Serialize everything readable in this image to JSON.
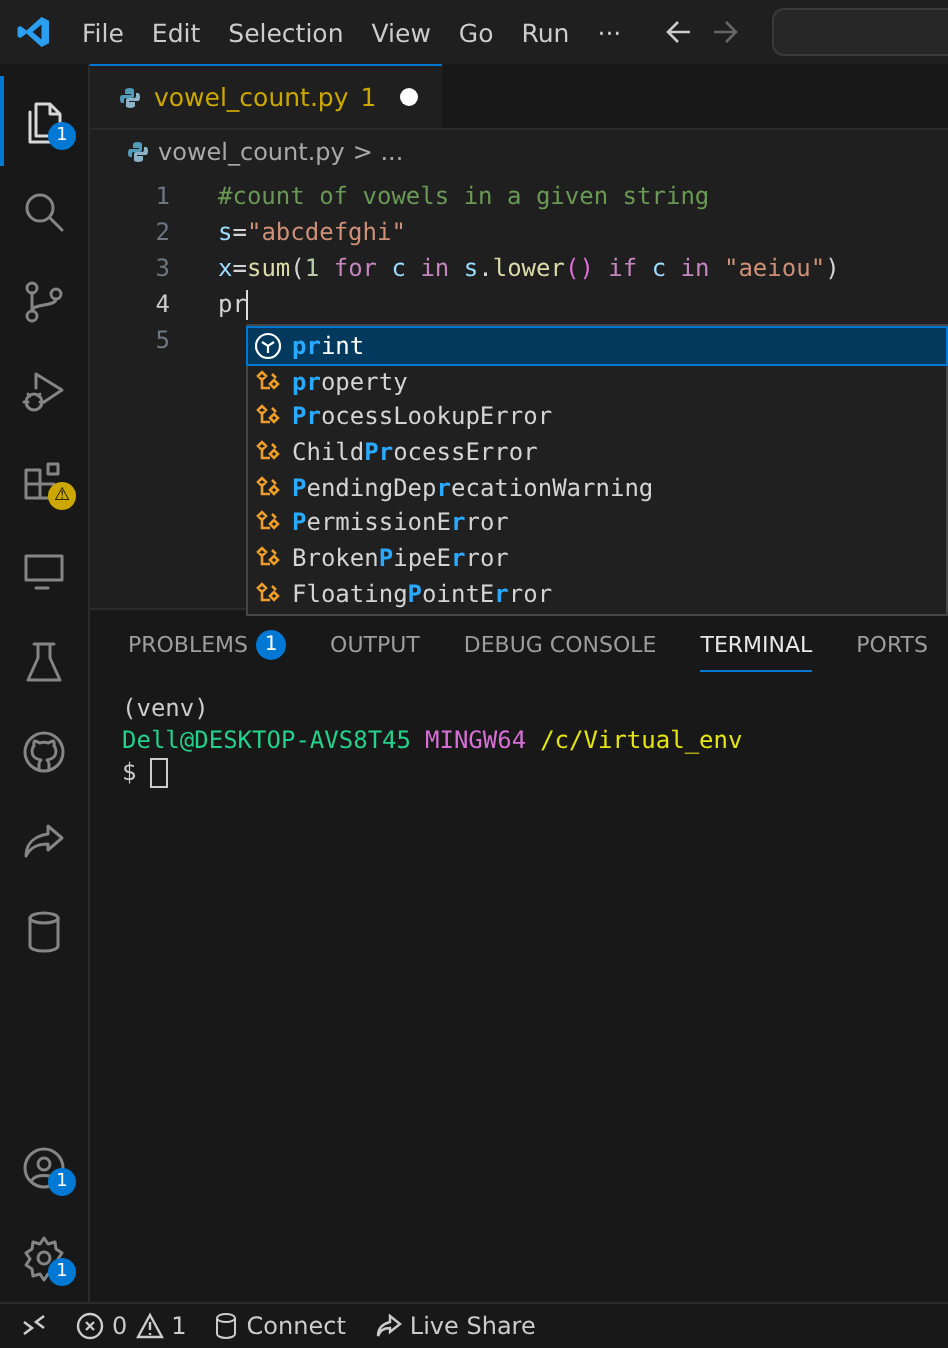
{
  "menu": [
    "File",
    "Edit",
    "Selection",
    "View",
    "Go",
    "Run",
    "···"
  ],
  "activity_bar": [
    {
      "kind": "files",
      "badge": "1",
      "selected": true
    },
    {
      "kind": "search",
      "selected": false
    },
    {
      "kind": "branch",
      "selected": false
    },
    {
      "kind": "debug",
      "selected": false
    },
    {
      "kind": "extensions",
      "badge": "⚠",
      "selected": false
    },
    {
      "kind": "remote",
      "selected": false
    },
    {
      "kind": "flask",
      "selected": false
    },
    {
      "kind": "github",
      "selected": false
    },
    {
      "kind": "share",
      "selected": false
    },
    {
      "kind": "database",
      "selected": false
    }
  ],
  "activity_bottom": [
    {
      "kind": "account",
      "badge": "1"
    },
    {
      "kind": "gear",
      "badge": "1"
    }
  ],
  "tab": {
    "name": "vowel_count.py",
    "problems": "1",
    "modified": true
  },
  "breadcrumb": {
    "file": "vowel_count.py",
    "rest": "> ..."
  },
  "code": [
    {
      "number": "1",
      "current": false,
      "tokens": [
        {
          "kind": "comment",
          "text": "#count of vowels in a given string"
        }
      ]
    },
    {
      "number": "2",
      "current": false,
      "tokens": [
        {
          "kind": "name",
          "text": "s"
        },
        {
          "kind": "plain",
          "text": "="
        },
        {
          "kind": "string",
          "text": "\"abcdefghi\""
        }
      ]
    },
    {
      "number": "3",
      "current": false,
      "tokens": [
        {
          "kind": "name",
          "text": "x"
        },
        {
          "kind": "plain",
          "text": "="
        },
        {
          "kind": "func",
          "text": "sum"
        },
        {
          "kind": "plain",
          "text": "("
        },
        {
          "kind": "number",
          "text": "1"
        },
        {
          "kind": "keyword",
          "text": " for "
        },
        {
          "kind": "name",
          "text": "c"
        },
        {
          "kind": "keyword",
          "text": " in "
        },
        {
          "kind": "name",
          "text": "s"
        },
        {
          "kind": "plain",
          "text": "."
        },
        {
          "kind": "func",
          "text": "lower"
        },
        {
          "kind": "paren",
          "text": "()"
        },
        {
          "kind": "keyword",
          "text": " if "
        },
        {
          "kind": "name",
          "text": "c"
        },
        {
          "kind": "keyword",
          "text": " in "
        },
        {
          "kind": "string",
          "text": "\"aeiou\""
        },
        {
          "kind": "plain",
          "text": ")"
        }
      ]
    },
    {
      "number": "4",
      "current": true,
      "tokens": [
        {
          "kind": "plain",
          "text": "pr"
        }
      ]
    },
    {
      "number": "5",
      "current": false
    }
  ],
  "suggestions": [
    {
      "kind": "function",
      "selected": true,
      "parts": [
        {
          "text": "pr",
          "match": true
        },
        {
          "text": "int",
          "match": false
        }
      ]
    },
    {
      "kind": "class",
      "selected": false,
      "parts": [
        {
          "text": "pr",
          "match": true
        },
        {
          "text": "operty",
          "match": false
        }
      ]
    },
    {
      "kind": "class",
      "selected": false,
      "parts": [
        {
          "text": "Pr",
          "match": true
        },
        {
          "text": "ocessLookupError",
          "match": false
        }
      ]
    },
    {
      "kind": "class",
      "selected": false,
      "parts": [
        {
          "text": "Child",
          "match": false
        },
        {
          "text": "Pr",
          "match": true
        },
        {
          "text": "ocessError",
          "match": false
        }
      ]
    },
    {
      "kind": "class",
      "selected": false,
      "parts": [
        {
          "text": "P",
          "match": true
        },
        {
          "text": "endingDep",
          "match": false
        },
        {
          "text": "r",
          "match": true
        },
        {
          "text": "ecationWarning",
          "match": false
        }
      ]
    },
    {
      "kind": "class",
      "selected": false,
      "parts": [
        {
          "text": "P",
          "match": true
        },
        {
          "text": "ermissionE",
          "match": false
        },
        {
          "text": "r",
          "match": true
        },
        {
          "text": "ror",
          "match": false
        }
      ]
    },
    {
      "kind": "class",
      "selected": false,
      "parts": [
        {
          "text": "Broken",
          "match": false
        },
        {
          "text": "P",
          "match": true
        },
        {
          "text": "ipeE",
          "match": false
        },
        {
          "text": "r",
          "match": true
        },
        {
          "text": "ror",
          "match": false
        }
      ]
    },
    {
      "kind": "class",
      "selected": false,
      "parts": [
        {
          "text": "Floating",
          "match": false
        },
        {
          "text": "P",
          "match": true
        },
        {
          "text": "ointE",
          "match": false
        },
        {
          "text": "r",
          "match": true
        },
        {
          "text": "ror",
          "match": false
        }
      ]
    }
  ],
  "panel_tabs": [
    {
      "label": "PROBLEMS",
      "badge": "1",
      "selected": false
    },
    {
      "label": "OUTPUT",
      "selected": false
    },
    {
      "label": "DEBUG CONSOLE",
      "selected": false
    },
    {
      "label": "TERMINAL",
      "selected": true
    },
    {
      "label": "PORTS",
      "selected": false
    }
  ],
  "terminal": {
    "venv": "(venv)",
    "user": "Dell@DESKTOP-AVS8T45",
    "shell": "MINGW64",
    "path": "/c/Virtual_env",
    "prompt": "$"
  },
  "status_bar": {
    "errors": "0",
    "warnings": "1",
    "connect": "Connect",
    "live_share": "Live Share"
  }
}
